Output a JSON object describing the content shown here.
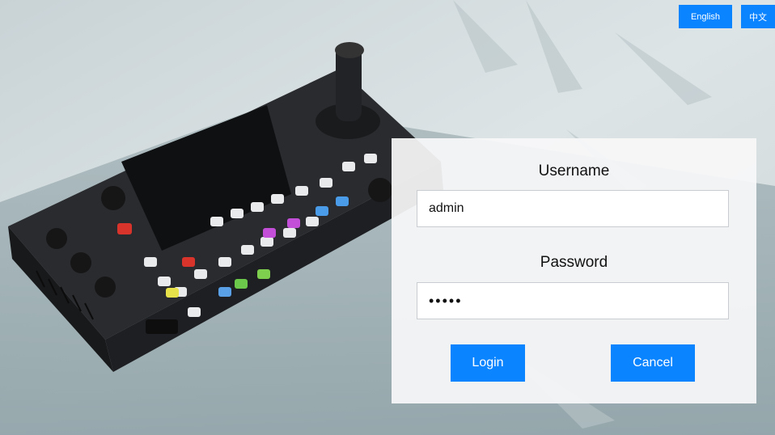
{
  "language": {
    "english_label": "English",
    "chinese_label": "中文"
  },
  "login": {
    "username_label": "Username",
    "username_value": "admin",
    "password_label": "Password",
    "password_value": "•••••",
    "login_label": "Login",
    "cancel_label": "Cancel"
  },
  "colors": {
    "accent": "#0a84ff",
    "panel": "#f7f8f9"
  }
}
